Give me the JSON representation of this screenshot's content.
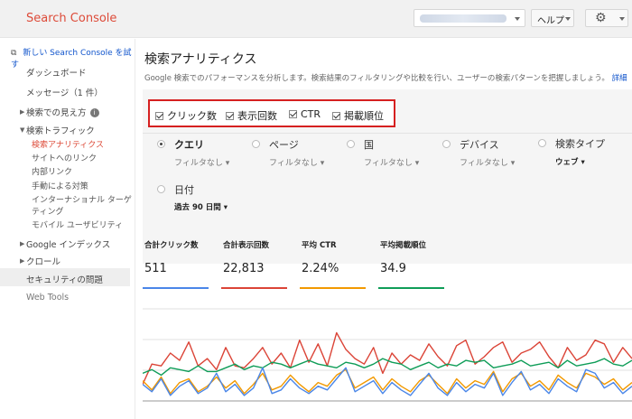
{
  "header": {
    "brand": "Search Console",
    "help_label": "ヘルプ",
    "settings_icon": "gear-icon"
  },
  "sidebar": {
    "new_console_link": "新しい Search Console を試す",
    "items": [
      {
        "label": "ダッシュボード"
      },
      {
        "label": "メッセージ（1 件）"
      },
      {
        "label": "検索での見え方"
      },
      {
        "label": "検索トラフィック"
      },
      {
        "label": "Google インデックス"
      },
      {
        "label": "クロール"
      },
      {
        "label": "セキュリティの問題"
      },
      {
        "label": "Web Tools"
      }
    ],
    "subitems": [
      {
        "label": "検索アナリティクス"
      },
      {
        "label": "サイトへのリンク"
      },
      {
        "label": "内部リンク"
      },
      {
        "label": "手動による対策"
      },
      {
        "label": "インターナショナル ターゲ"
      },
      {
        "label": "ティング"
      },
      {
        "label": "モバイル ユーザビリティ"
      }
    ]
  },
  "main": {
    "title": "検索アナリティクス",
    "description": "Google 検索でのパフォーマンスを分析します。検索結果のフィルタリングや比較を行い、ユーザーの検索パターンを把握しましょう。",
    "details_link": "詳細",
    "checkboxes": [
      {
        "label": "クリック数",
        "checked": true
      },
      {
        "label": "表示回数",
        "checked": true
      },
      {
        "label": "CTR",
        "checked": true
      },
      {
        "label": "掲載順位",
        "checked": true
      }
    ],
    "dimensions": [
      {
        "label": "クエリ",
        "filter": "フィルタなし",
        "selected": true
      },
      {
        "label": "ページ",
        "filter": "フィルタなし",
        "selected": false
      },
      {
        "label": "国",
        "filter": "フィルタなし",
        "selected": false
      },
      {
        "label": "デバイス",
        "filter": "フィルタなし",
        "selected": false
      },
      {
        "label": "検索タイプ",
        "filter": "ウェブ",
        "selected": false
      },
      {
        "label": "日付",
        "filter": "過去 90 日間",
        "selected": false
      }
    ],
    "metrics": [
      {
        "label": "合計クリック数",
        "value": "511",
        "color": "#4a86e8"
      },
      {
        "label": "合計表示回数",
        "value": "22,813",
        "color": "#db4437"
      },
      {
        "label": "平均 CTR",
        "value": "2.24%",
        "color": "#f29900"
      },
      {
        "label": "平均掲載順位",
        "value": "34.9",
        "color": "#0f9d58"
      }
    ]
  },
  "chart_data": {
    "type": "line",
    "series": [
      {
        "color": "#db4437",
        "values": [
          18,
          40,
          38,
          52,
          44,
          64,
          38,
          46,
          34,
          58,
          38,
          36,
          46,
          58,
          40,
          52,
          36,
          66,
          42,
          62,
          38,
          74,
          56,
          46,
          40,
          58,
          30,
          52,
          40,
          50,
          44,
          62,
          48,
          38,
          60,
          66,
          40,
          48,
          58,
          64,
          42,
          52,
          56,
          64,
          48,
          36,
          58,
          44,
          50,
          66,
          62,
          42,
          58,
          46
        ]
      },
      {
        "color": "#0f9d58",
        "values": [
          30,
          34,
          28,
          36,
          34,
          32,
          38,
          32,
          32,
          36,
          40,
          34,
          38,
          36,
          42,
          40,
          36,
          40,
          44,
          40,
          38,
          36,
          42,
          40,
          36,
          40,
          46,
          42,
          40,
          34,
          38,
          42,
          36,
          40,
          38,
          44,
          42,
          44,
          36,
          38,
          40,
          44,
          38,
          40,
          42,
          36,
          44,
          38,
          40,
          42,
          46,
          40,
          38,
          44
        ]
      },
      {
        "color": "#f29900",
        "values": [
          22,
          12,
          26,
          8,
          20,
          24,
          10,
          16,
          26,
          14,
          22,
          8,
          18,
          30,
          12,
          16,
          28,
          18,
          10,
          20,
          16,
          28,
          34,
          14,
          20,
          26,
          12,
          24,
          16,
          10,
          22,
          28,
          18,
          8,
          24,
          14,
          22,
          18,
          32,
          10,
          24,
          30,
          16,
          22,
          12,
          28,
          20,
          14,
          30,
          26,
          18,
          24,
          12,
          20
        ]
      },
      {
        "color": "#4a86e8",
        "values": [
          18,
          10,
          24,
          6,
          16,
          22,
          8,
          14,
          30,
          10,
          18,
          6,
          14,
          36,
          8,
          12,
          24,
          14,
          8,
          16,
          12,
          24,
          36,
          10,
          16,
          22,
          8,
          20,
          12,
          6,
          18,
          30,
          14,
          6,
          20,
          10,
          18,
          14,
          30,
          6,
          20,
          32,
          12,
          18,
          8,
          24,
          16,
          10,
          34,
          30,
          14,
          20,
          8,
          16
        ]
      }
    ],
    "ylim": [
      0,
      100
    ],
    "grid": true
  }
}
